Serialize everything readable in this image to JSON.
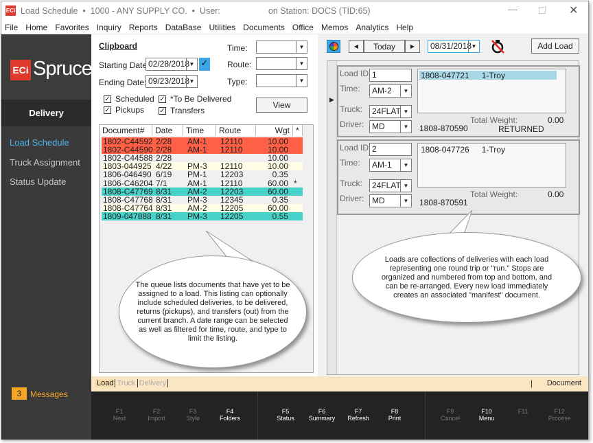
{
  "window": {
    "title": "Load Schedule",
    "company": "1000 - ANY SUPPLY CO.",
    "user_label": "User:",
    "station": "on Station: DOCS (TID:65)",
    "logo_text": "ECi"
  },
  "menu": [
    "File",
    "Home",
    "Favorites",
    "Inquiry",
    "Reports",
    "DataBase",
    "Utilities",
    "Documents",
    "Office",
    "Memos",
    "Analytics",
    "Help"
  ],
  "sidebar": {
    "brand": "ECi Spruce",
    "section": "Delivery",
    "items": [
      "Load Schedule",
      "Truck Assignment",
      "Status Update"
    ],
    "messages_count": "3",
    "messages_label": "Messages",
    "accent": "#4fb3e8"
  },
  "clipboard": {
    "title": "Clipboard",
    "starting_label": "Starting Date:",
    "starting_value": "02/28/2018",
    "ending_label": "Ending Date:",
    "ending_value": "09/23/2018",
    "time_label": "Time:",
    "route_label": "Route:",
    "type_label": "Type:",
    "time_value": "",
    "route_value": "",
    "type_value": "",
    "checks": [
      {
        "label": "Scheduled",
        "checked": true
      },
      {
        "label": "Pickups",
        "checked": true
      },
      {
        "label": "*To Be Delivered",
        "checked": true
      },
      {
        "label": "Transfers",
        "checked": true
      }
    ],
    "view_button": "View"
  },
  "queue": {
    "columns": [
      "Document#",
      "Date",
      "Time",
      "Route",
      "Wgt",
      "*"
    ],
    "rows": [
      {
        "doc": "1802-C44592",
        "date": "2/28",
        "time": "AM-1",
        "route": "12110",
        "wgt": "10.00",
        "flag": "",
        "color": "#ff5f45"
      },
      {
        "doc": "1802-C44590",
        "date": "2/28",
        "time": "AM-1",
        "route": "12110",
        "wgt": "10.00",
        "flag": "",
        "color": "#ff5f45"
      },
      {
        "doc": "1802-C44588",
        "date": "2/28",
        "time": "",
        "route": "",
        "wgt": "10.00",
        "flag": "",
        "color": ""
      },
      {
        "doc": "1803-044925",
        "date": "4/22",
        "time": "PM-3",
        "route": "12110",
        "wgt": "10.00",
        "flag": "",
        "color": "#fffde6"
      },
      {
        "doc": "1806-046490",
        "date": "6/19",
        "time": "PM-1",
        "route": "12203",
        "wgt": "0.35",
        "flag": "",
        "color": ""
      },
      {
        "doc": "1806-C46204",
        "date": "7/1",
        "time": "AM-1",
        "route": "12110",
        "wgt": "60.00",
        "flag": "*",
        "color": ""
      },
      {
        "doc": "1808-C47769",
        "date": "8/31",
        "time": "AM-2",
        "route": "12203",
        "wgt": "60.00",
        "flag": "",
        "color": "#48d1c8"
      },
      {
        "doc": "1808-C47768",
        "date": "8/31",
        "time": "PM-3",
        "route": "12345",
        "wgt": "0.35",
        "flag": "",
        "color": ""
      },
      {
        "doc": "1808-C47764",
        "date": "8/31",
        "time": "AM-2",
        "route": "12205",
        "wgt": "60.00",
        "flag": "",
        "color": "#fffde6"
      },
      {
        "doc": "1809-047888",
        "date": "8/31",
        "time": "PM-3",
        "route": "12205",
        "wgt": "0.55",
        "flag": "",
        "color": "#48d1c8"
      }
    ]
  },
  "toolbar": {
    "today": "Today",
    "date": "08/31/2018",
    "add_load": "Add Load"
  },
  "loads": [
    {
      "id_label": "Load ID:",
      "id": "1",
      "time_label": "Time:",
      "time": "AM-2",
      "truck_label": "Truck:",
      "truck": "24FLAT",
      "driver_label": "Driver:",
      "driver": "MD",
      "stop_doc": "1808-047721",
      "stop_name": "1-Troy",
      "manifest": "1808-870590",
      "weight_label": "Total Weight:",
      "weight": "0.00",
      "status": "RETURNED"
    },
    {
      "id_label": "Load ID:",
      "id": "2",
      "time_label": "Time:",
      "time": "AM-1",
      "truck_label": "Truck:",
      "truck": "24FLAT",
      "driver_label": "Driver:",
      "driver": "MD",
      "stop_doc": "1808-047726",
      "stop_name": "1-Troy",
      "manifest": "1808-870591",
      "weight_label": "Total Weight:",
      "weight": "0.00",
      "status": ""
    }
  ],
  "tabs": {
    "items": [
      "Load",
      "Truck",
      "Delivery"
    ],
    "right": "Document"
  },
  "fkeys": [
    {
      "key": "F1",
      "label": "Next",
      "on": false
    },
    {
      "key": "F2",
      "label": "Import",
      "on": false
    },
    {
      "key": "F3",
      "label": "Style",
      "on": false
    },
    {
      "key": "F4",
      "label": "Folders",
      "on": true
    },
    {
      "key": "F5",
      "label": "Status",
      "on": true
    },
    {
      "key": "F6",
      "label": "Summary",
      "on": true
    },
    {
      "key": "F7",
      "label": "Refresh",
      "on": true
    },
    {
      "key": "F8",
      "label": "Print",
      "on": true
    },
    {
      "key": "F9",
      "label": "Cancel",
      "on": false
    },
    {
      "key": "F10",
      "label": "Menu",
      "on": true
    },
    {
      "key": "F11",
      "label": "",
      "on": false
    },
    {
      "key": "F12",
      "label": "Process",
      "on": false
    }
  ],
  "callouts": {
    "queue": "The queue lists documents that have yet to be assigned to a load. This listing can optionally include scheduled deliveries, to be delivered, returns (pickups), and transfers (out) from the current branch. A date range can be selected as well as filtered for time, route, and type to limit the listing.",
    "loads": "Loads are collections of deliveries with each load representing one round trip or \"run.\" Stops are organized and numbered from top and bottom, and can be re-arranged. Every new load immediately creates an associated \"manifest\" document."
  }
}
